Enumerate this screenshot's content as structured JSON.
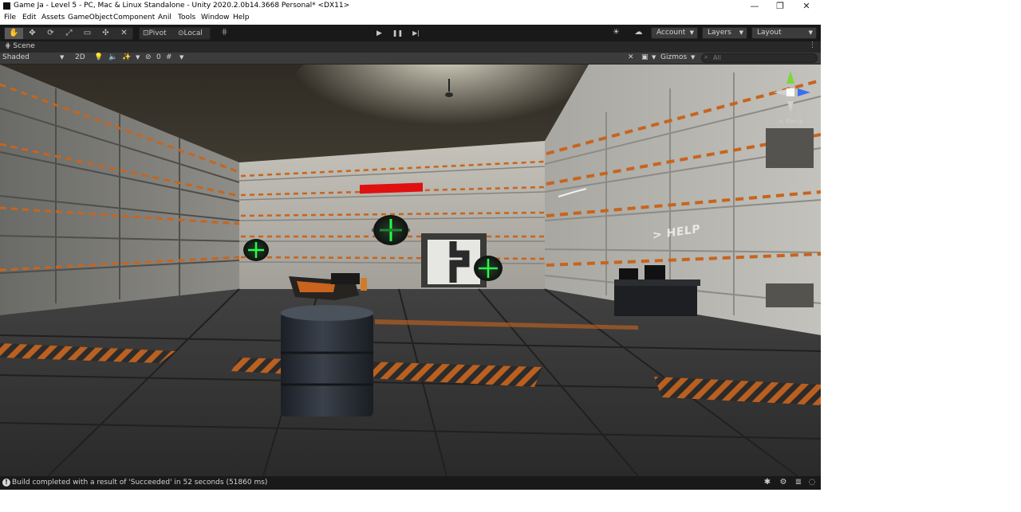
{
  "window": {
    "title": "Game Ja - Level 5 - PC, Mac & Linux Standalone - Unity 2020.2.0b14.3668 Personal* <DX11>",
    "minimize": "—",
    "maximize": "❐",
    "close": "✕"
  },
  "menu": [
    "File",
    "Edit",
    "Assets",
    "GameObject",
    "Component",
    "Anil",
    "Tools",
    "Window",
    "Help"
  ],
  "toolbar": {
    "pivot": "Pivot",
    "local": "Local",
    "account": "Account",
    "layers": "Layers",
    "layout": "Layout",
    "play": "▶",
    "pause": "❚❚",
    "step": "▶|"
  },
  "scene_tab": {
    "label": "Scene",
    "menu": "⋮"
  },
  "scene_toolbar": {
    "draw_mode": "Shaded",
    "mode_2d": "2D",
    "hidden_count": "0",
    "gizmos": "Gizmos",
    "search_placeholder": "All"
  },
  "viewport": {
    "help_text": "> HELP",
    "persp_label": "< Persp",
    "gizmo_axes": {
      "y": "y",
      "z": "z"
    }
  },
  "status": {
    "message": "Build completed with a result of 'Succeeded' in 52 seconds (51860 ms)"
  },
  "colors": {
    "editor_bg": "#383838",
    "toolbar_bg": "#191919",
    "hazard_orange": "#c8641e",
    "enemy_green": "#22ff44",
    "health_red": "#e01010"
  }
}
